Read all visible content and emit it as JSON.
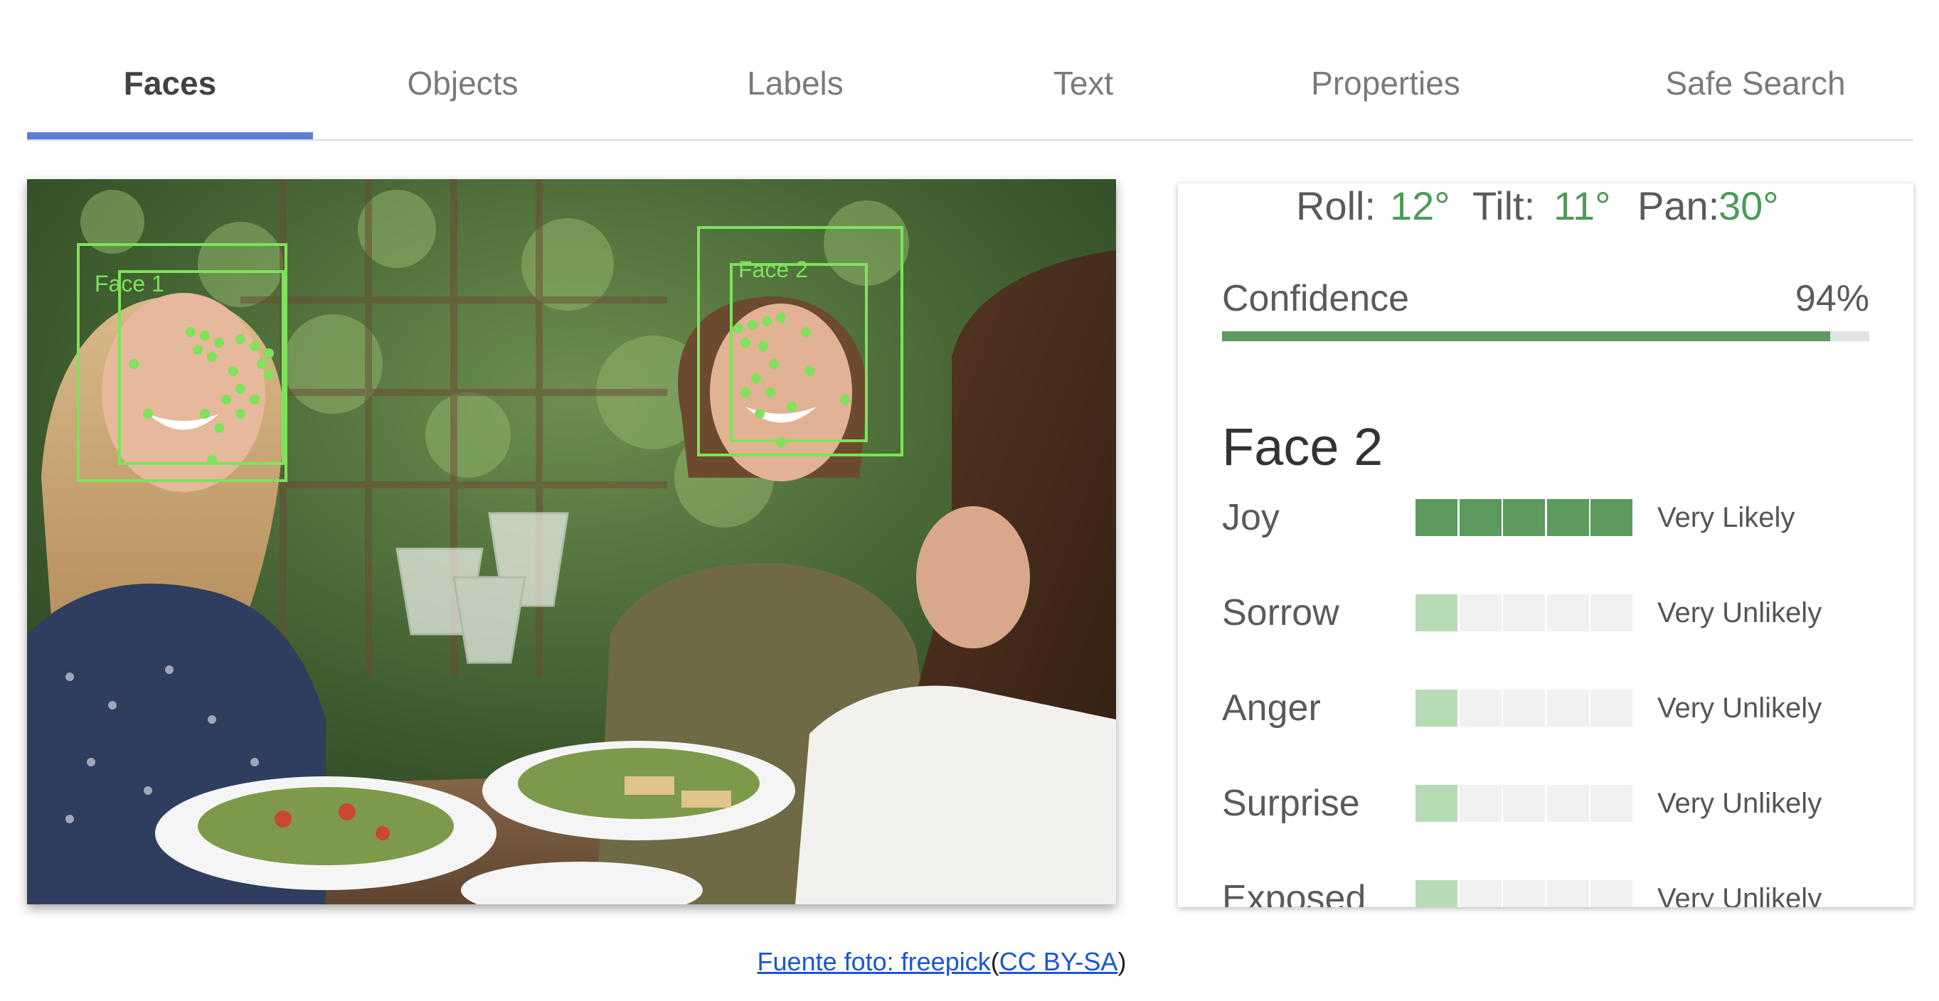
{
  "tabs": [
    {
      "label": "Faces",
      "active": true
    },
    {
      "label": "Objects",
      "active": false
    },
    {
      "label": "Labels",
      "active": false
    },
    {
      "label": "Text",
      "active": false
    },
    {
      "label": "Properties",
      "active": false
    },
    {
      "label": "Safe Search",
      "active": false
    }
  ],
  "photo": {
    "face_labels": [
      "Face 1",
      "Face 2"
    ],
    "box_color": "#7ee25a"
  },
  "panel": {
    "angles": {
      "roll_label": "Roll:",
      "roll_value": "12°",
      "tilt_label": "Tilt:",
      "tilt_value": "11°",
      "pan_label": "Pan:",
      "pan_value": "30°"
    },
    "confidence": {
      "label": "Confidence",
      "value": "94%",
      "fraction": 0.94
    },
    "face_title": "Face 2",
    "emotions": [
      {
        "label": "Joy",
        "likelihood": "Very Likely",
        "level": 5
      },
      {
        "label": "Sorrow",
        "likelihood": "Very Unlikely",
        "level": 1
      },
      {
        "label": "Anger",
        "likelihood": "Very Unlikely",
        "level": 1
      },
      {
        "label": "Surprise",
        "likelihood": "Very Unlikely",
        "level": 1
      },
      {
        "label": "Exposed",
        "likelihood": "Very Unlikely",
        "level": 1
      }
    ]
  },
  "credit": {
    "source_link": "Fuente foto: freepick",
    "open_paren": "(",
    "license_link": "CC BY-SA",
    "close_paren": ")"
  },
  "colors": {
    "accent_tab": "#5b7fd6",
    "value_green": "#4e9a5a",
    "meter_strong": "#5c9a5e",
    "meter_weak": "#b7dbb4",
    "link": "#1a56d6"
  }
}
